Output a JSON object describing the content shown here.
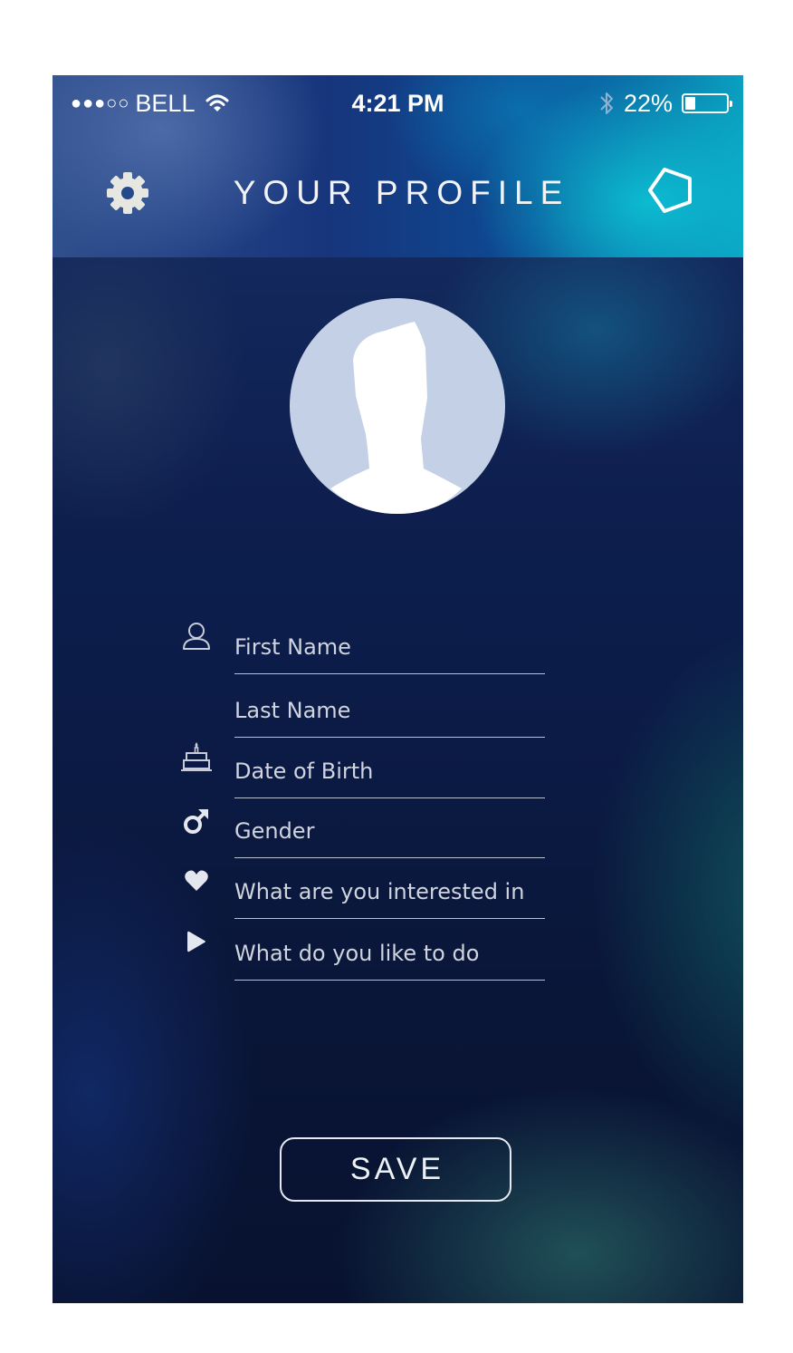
{
  "status_bar": {
    "signal_dots": "●●●○○",
    "carrier": "BELL",
    "time": "4:21 PM",
    "battery_percent": "22%",
    "battery_level": 0.22
  },
  "header": {
    "title": "YOUR PROFILE",
    "left_icon": "gear-icon",
    "right_icon": "pentagon-icon"
  },
  "avatar": {
    "icon": "user-silhouette-icon"
  },
  "form": {
    "fields": [
      {
        "icon": "user-icon",
        "placeholder": "First Name"
      },
      {
        "icon": "",
        "placeholder": "Last Name"
      },
      {
        "icon": "birthday-cake-icon",
        "placeholder": "Date of Birth"
      },
      {
        "icon": "male-symbol-icon",
        "placeholder": "Gender"
      },
      {
        "icon": "heart-icon",
        "placeholder": "What are you interested in"
      },
      {
        "icon": "play-icon",
        "placeholder": "What do you like to do"
      }
    ]
  },
  "save_button": {
    "label": "SAVE"
  },
  "colors": {
    "field_underline": "#b9c2d3",
    "text": "#d8dce5",
    "avatar_bg": "#c3d0e6"
  }
}
